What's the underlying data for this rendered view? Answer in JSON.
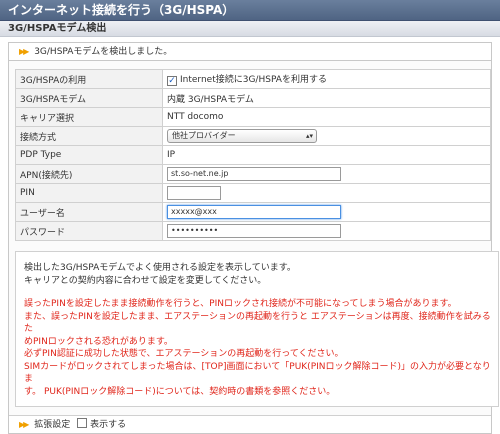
{
  "page_title": "インターネット接続を行う（3G/HSPA）",
  "section_title": "3G/HSPAモデム検出",
  "status_message": "3G/HSPAモデムを検出しました。",
  "rows": {
    "use": {
      "label": "3G/HSPAの利用",
      "checkbox_label": "Internet接続に3G/HSPAを利用する",
      "checked": true
    },
    "modem": {
      "label": "3G/HSPAモデム",
      "value": "内蔵 3G/HSPAモデム"
    },
    "carrier": {
      "label": "キャリア選択",
      "value": "NTT docomo"
    },
    "method": {
      "label": "接続方式",
      "selected": "他社プロバイダー"
    },
    "pdp": {
      "label": "PDP Type",
      "value": "IP"
    },
    "apn": {
      "label": "APN(接続先)",
      "value": "st.so-net.ne.jp"
    },
    "pin": {
      "label": "PIN",
      "value": ""
    },
    "user": {
      "label": "ユーザー名",
      "value": "xxxxx@xxx"
    },
    "password": {
      "label": "パスワード",
      "value": "••••••••••"
    }
  },
  "info": {
    "intro": [
      "検出した3G/HSPAモデムでよく使用される設定を表示しています。",
      "キャリアとの契約内容に合わせて設定を変更してください。"
    ],
    "warnings": [
      "誤ったPINを設定したまま接続動作を行うと、PINロックされ接続が不可能になってしまう場合があります。",
      "また、誤ったPINを設定したまま、エアステーションの再起動を行うと エアステーションは再度、接続動作を試みるた",
      "めPINロックされる恐れがあります。",
      "必ずPIN認証に成功した状態で、エアステーションの再起動を行ってください。",
      "SIMカードがロックされてしまった場合は、[TOP]画面において「PUK(PINロック解除コード)」の入力が必要となりま",
      "す。 PUK(PINロック解除コード)については、契約時の書類を参照ください。"
    ]
  },
  "advanced": {
    "label": "拡張設定",
    "checkbox_label": "表示する",
    "checked": false
  },
  "colors": {
    "title_bar": "#5a6f8f",
    "warning_text": "#e0261b",
    "accent_arrow": "#f0a000"
  },
  "icons": {
    "section_arrow": "double-chevron-right-icon",
    "select_arrow": "up-down-chevron-icon"
  }
}
